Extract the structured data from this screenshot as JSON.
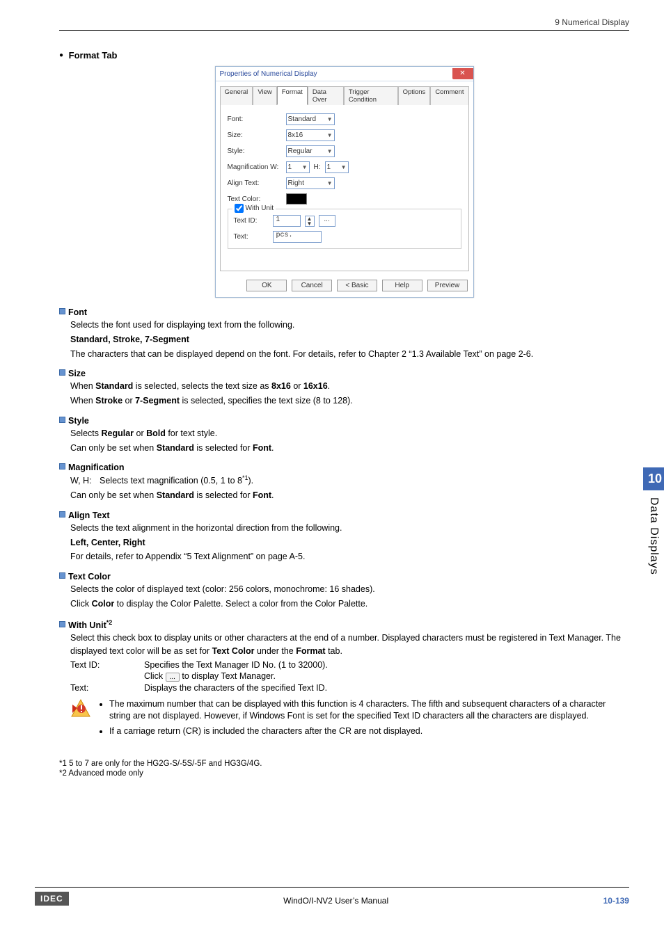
{
  "header": {
    "breadcrumb": "9 Numerical Display"
  },
  "section": {
    "title": "Format",
    "suffix": " Tab"
  },
  "dialog": {
    "title": "Properties of Numerical Display",
    "tabs": [
      "General",
      "View",
      "Format",
      "Data Over",
      "Trigger Condition",
      "Options",
      "Comment"
    ],
    "activeTab": "Format",
    "fields": {
      "fontLabel": "Font:",
      "fontValue": "Standard",
      "sizeLabel": "Size:",
      "sizeValue": "8x16",
      "styleLabel": "Style:",
      "styleValue": "Regular",
      "magLabel": "Magnification W:",
      "magW": "1",
      "magHLabel": "H:",
      "magH": "1",
      "alignLabel": "Align Text:",
      "alignValue": "Right",
      "colorLabel": "Text Color:",
      "unitGroup": "With Unit",
      "textIdLabel": "Text ID:",
      "textIdValue": "1",
      "textLabel": "Text:",
      "textValue": "pcs."
    },
    "buttons": {
      "ok": "OK",
      "cancel": "Cancel",
      "basic": "< Basic",
      "help": "Help",
      "preview": "Preview"
    }
  },
  "items": {
    "font": {
      "title": "Font",
      "line1": "Selects the font used for displaying text from the following.",
      "bold_list": "Standard, Stroke, 7-Segment",
      "line2": "The characters that can be displayed depend on the font. For details, refer to Chapter 2 “1.3 Available Text” on page 2-6."
    },
    "size": {
      "title": "Size",
      "line1_pre": "When ",
      "line1_b1": "Standard",
      "line1_mid": " is selected, selects the text size as ",
      "line1_b2": "8x16",
      "line1_or": " or ",
      "line1_b3": "16x16",
      "line1_end": ".",
      "line2_pre": "When ",
      "line2_b1": "Stroke",
      "line2_or": " or ",
      "line2_b2": "7-Segment",
      "line2_end": " is selected, specifies the text size (8 to 128)."
    },
    "style": {
      "title": "Style",
      "line1_pre": "Selects ",
      "line1_b1": "Regular",
      "line1_or": " or ",
      "line1_b2": "Bold",
      "line1_end": " for text style.",
      "line2_pre": "Can only be set when ",
      "line2_b1": "Standard",
      "line2_mid": " is selected for ",
      "line2_b2": "Font",
      "line2_end": "."
    },
    "mag": {
      "title": "Magnification",
      "wh": "W, H:",
      "line1": "Selects text magnification (0.5, 1 to 8",
      "sup": "*1",
      "line1end": ").",
      "line2_pre": "Can only be set when ",
      "line2_b1": "Standard",
      "line2_mid": " is selected for ",
      "line2_b2": "Font",
      "line2_end": "."
    },
    "align": {
      "title": "Align Text",
      "line1": "Selects the text alignment in the horizontal direction from the following.",
      "bold_list": "Left, Center, Right",
      "line2": "For details, refer to Appendix “5 Text Alignment” on page A-5."
    },
    "color": {
      "title": "Text Color",
      "line1": "Selects the color of displayed text (color: 256 colors, monochrome: 16 shades).",
      "line2_pre": "Click ",
      "line2_b": "Color",
      "line2_end": " to display the Color Palette. Select a color from the Color Palette."
    },
    "unit": {
      "title": "With Unit",
      "sup": "*2",
      "line1_pre": "Select this check box to display units or other characters at the end of a number. Displayed characters must be registered in Text Manager. The displayed text color will be as set for ",
      "line1_b1": "Text Color",
      "line1_mid": " under the ",
      "line1_b2": "Format",
      "line1_end": " tab.",
      "textid_k": "Text ID:",
      "textid_v": "Specifies the Text Manager ID No. (1 to 32000).",
      "textid_v2_pre": "Click ",
      "textid_v2_end": " to display Text Manager.",
      "text_k": "Text:",
      "text_v": "Displays the characters of the specified Text ID.",
      "note1": "The maximum number that can be displayed with this function is 4 characters. The fifth and subsequent characters of a character string are not displayed. However, if Windows Font is set for the specified Text ID characters all the characters are displayed.",
      "note2": "If a carriage return (CR) is included the characters after the CR are not displayed."
    }
  },
  "footnotes": {
    "f1": "*1  5 to 7 are only for the HG2G-S/-5S/-5F and HG3G/4G.",
    "f2": "*2  Advanced mode only"
  },
  "sidetab": {
    "chapter": "10",
    "title": "Data Displays"
  },
  "footer": {
    "logo": "IDEC",
    "center": "WindO/I-NV2 User’s Manual",
    "page": "10-139"
  },
  "icons": {
    "ellipsis": "..."
  }
}
